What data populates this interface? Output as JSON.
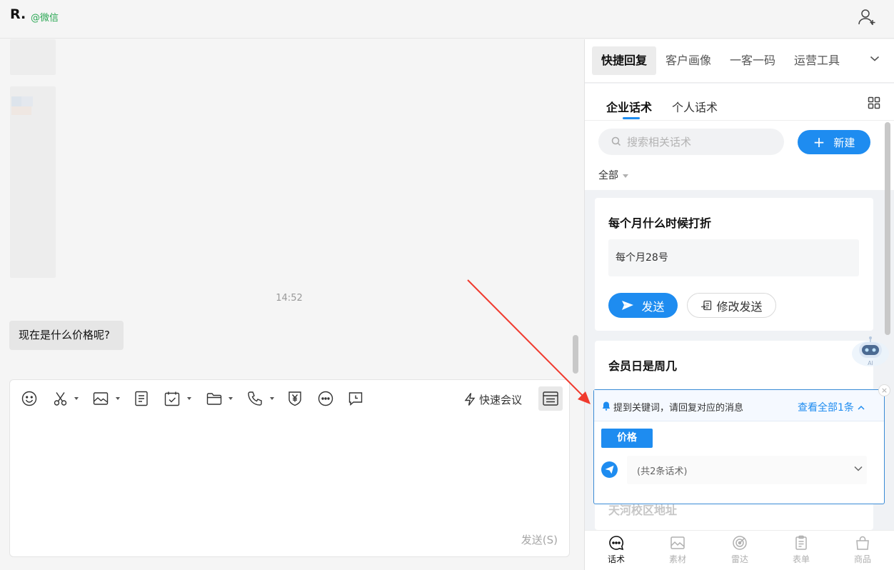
{
  "header": {
    "title": "R.",
    "subtitle": "@微信"
  },
  "chat": {
    "timestamp": "14:52",
    "messages": [
      {
        "text": "现在是什么价格呢?"
      }
    ]
  },
  "composer": {
    "toolbar": [
      {
        "name": "emoji-icon"
      },
      {
        "name": "screenshot-scissors-icon",
        "dropdown": true
      },
      {
        "name": "image-icon",
        "dropdown": true
      },
      {
        "name": "document-icon"
      },
      {
        "name": "schedule-check-icon",
        "dropdown": true
      },
      {
        "name": "folder-icon",
        "dropdown": true
      },
      {
        "name": "phone-icon",
        "dropdown": true
      },
      {
        "name": "yuan-shield-icon"
      },
      {
        "name": "more-icon"
      },
      {
        "name": "chat-clock-icon"
      }
    ],
    "quick_meeting": "快速会议",
    "send": "发送(S)"
  },
  "panel": {
    "tabs": [
      "快捷回复",
      "客户画像",
      "一客一码",
      "运营工具"
    ],
    "active_tab": 0,
    "subtabs": [
      "企业话术",
      "个人话术"
    ],
    "active_subtab": 0,
    "search_placeholder": "搜索相关话术",
    "new_label": "新建",
    "filter": "全部",
    "cards": [
      {
        "title": "每个月什么时候打折",
        "content": "每个月28号",
        "send": "发送",
        "edit_send": "修改发送"
      },
      {
        "title": "会员日是周几"
      },
      {
        "title": "天河校区地址"
      }
    ],
    "keyword_popup": {
      "notice": "提到关键词，请回复对应的消息",
      "view_all": "查看全部1条",
      "keyword": "价格",
      "count": "(共2条话术)",
      "close": "×"
    },
    "robot_label": "AI",
    "bottom_nav": [
      "话术",
      "素材",
      "雷达",
      "表单",
      "商品"
    ],
    "active_nav": 0
  },
  "colors": {
    "accent": "#1e8cf0",
    "wechat_green": "#2aa753",
    "annotation_red": "#f03a2e"
  }
}
